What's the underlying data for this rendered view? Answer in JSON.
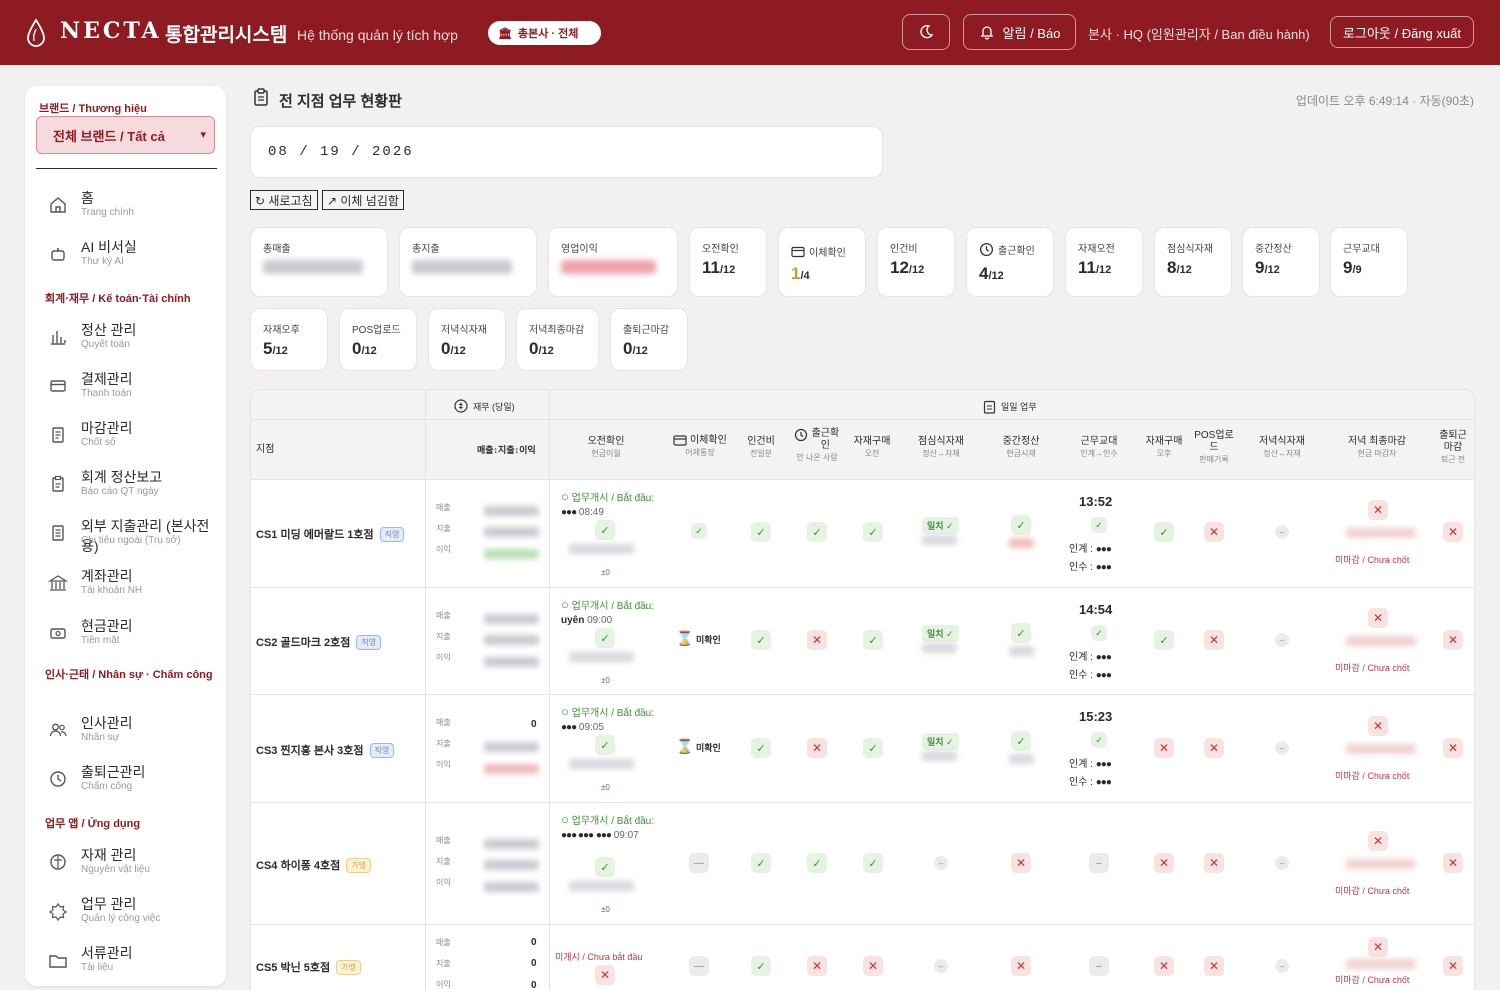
{
  "header": {
    "brand": "NECTA",
    "title_ko": "통합관리시스템",
    "title_vi": "Hệ thống quản lý tích hợp",
    "hq_badge": "총본사 · 전체",
    "alert_label": "알림 / Báo",
    "user_info": "본사 · HQ (임원관리자 / Ban điều hành)",
    "logout_label": "로그아웃 / Đăng xuất",
    "bg_color": "#8e1b22"
  },
  "sidebar": {
    "brand_label": "브랜드 / Thương hiệu",
    "brand_select": "전체 브랜드 / Tất cả",
    "sec_finance": "회계·재무 / Kế toán·Tài chính",
    "sec_hr": "인사·근태 / Nhân sự · Chấm công",
    "sec_app": "업무 앱 / Ứng dụng",
    "items": [
      {
        "ko": "홈",
        "vi": "Trang chính",
        "icon": "home-icon"
      },
      {
        "ko": "AI 비서실",
        "vi": "Thư ký AI",
        "icon": "robot-icon"
      },
      {
        "ko": "정산 관리",
        "vi": "Quyết toán",
        "icon": "bar-chart-icon"
      },
      {
        "ko": "결제관리",
        "vi": "Thanh toán",
        "icon": "card-icon"
      },
      {
        "ko": "마감관리",
        "vi": "Chốt số",
        "icon": "document-icon"
      },
      {
        "ko": "회계 정산보고",
        "vi": "Báo cáo QT ngày",
        "icon": "report-icon"
      },
      {
        "ko": "외부 지출관리 (본사전용)",
        "vi": "Chi tiêu ngoài (Trụ sở)",
        "icon": "expense-icon"
      },
      {
        "ko": "계좌관리",
        "vi": "Tài khoản NH",
        "icon": "bank-icon"
      },
      {
        "ko": "현금관리",
        "vi": "Tiền mặt",
        "icon": "cash-icon"
      },
      {
        "ko": "인사관리",
        "vi": "Nhân sự",
        "icon": "people-icon"
      },
      {
        "ko": "출퇴근관리",
        "vi": "Chấm công",
        "icon": "clock-icon"
      },
      {
        "ko": "자재 관리",
        "vi": "Nguyên vật liệu",
        "icon": "materials-icon"
      },
      {
        "ko": "업무 관리",
        "vi": "Quản lý công việc",
        "icon": "tasks-icon"
      },
      {
        "ko": "서류관리",
        "vi": "Tài liệu",
        "icon": "folder-icon"
      }
    ]
  },
  "main": {
    "title": "전 지점 업무 현황판",
    "updated": "업데이트 오후 6:49:14 · 자동(90초)",
    "date": "08 / 19 / 2026",
    "refresh_label": "↻ 새로고침",
    "transfer_label": "↗ 이체 넘김함"
  },
  "cards_row1": [
    {
      "label": "총매출",
      "blur": true,
      "color": "#c7c7d0"
    },
    {
      "label": "총지출",
      "blur": true,
      "color": "#c7c7d0"
    },
    {
      "label": "영업이익",
      "blur": true,
      "color": "#eea3ae"
    },
    {
      "label": "오전확인",
      "num": "11",
      "den": "/12"
    },
    {
      "label": "이체확인",
      "num": "1",
      "den": "/4",
      "icon": "card-icon",
      "num_color": "#d39a2c"
    },
    {
      "label": "인건비",
      "num": "12",
      "den": "/12"
    },
    {
      "label": "출근확인",
      "num": "4",
      "den": "/12",
      "icon": "clock-icon"
    },
    {
      "label": "자재오전",
      "num": "11",
      "den": "/12"
    },
    {
      "label": "점심식자재",
      "num": "8",
      "den": "/12"
    },
    {
      "label": "중간정산",
      "num": "9",
      "den": "/12"
    },
    {
      "label": "근무교대",
      "num": "9",
      "den": "/9"
    }
  ],
  "cards_row2": [
    {
      "label": "자재오후",
      "num": "5",
      "den": "/12"
    },
    {
      "label": "POS업로드",
      "num": "0",
      "den": "/12"
    },
    {
      "label": "저녁식자재",
      "num": "0",
      "den": "/12"
    },
    {
      "label": "저녁최종마감",
      "num": "0",
      "den": "/12"
    },
    {
      "label": "출퇴근마감",
      "num": "0",
      "den": "/12"
    }
  ],
  "table": {
    "group_finance": "재무 (당일)",
    "group_daily": "일일 업무",
    "col_branch": "지점",
    "col_fin": "매출↕지출↕이익",
    "columns": [
      {
        "t": "오전확인",
        "s": "현금이월"
      },
      {
        "t": "이체확인",
        "s": "어제통장"
      },
      {
        "t": "인건비",
        "s": "전일분"
      },
      {
        "t": "출근확인",
        "s": "안 나온 사람"
      },
      {
        "t": "자재구매",
        "s": "오전"
      },
      {
        "t": "점심식자재",
        "s": "정산↔자재"
      },
      {
        "t": "중간정산",
        "s": "현금시재"
      },
      {
        "t": "근무교대",
        "s": "인계→인수"
      },
      {
        "t": "자재구매",
        "s": "오후"
      },
      {
        "t": "POS업로드",
        "s": "판매기록"
      },
      {
        "t": "저녁식자재",
        "s": "정산↔자재"
      },
      {
        "t": "저녁 최종마감",
        "s": "현금 마감자"
      },
      {
        "t": "출퇴근 마감",
        "s": "퇴근 전"
      }
    ],
    "fin_labels": [
      "매출",
      "지출",
      "이익"
    ],
    "start_label": "업무개시 / Bắt đầu:",
    "not_started": "미개시 / Chưa bắt đầu",
    "unclosed": "미마감 / Chưa chốt",
    "unconfirmed": "미확인",
    "match": "일치 ✓",
    "handover": "인계 :",
    "takeover": "인수 :",
    "pm0": "±0",
    "zero": "0",
    "rows": [
      {
        "name": "CS1 미딩 에머랄드 1호점",
        "tag": "직영",
        "start_who": "●●●",
        "start_time": "08:49",
        "shift": "13:52"
      },
      {
        "name": "CS2 골드마크 2호점",
        "tag": "직영",
        "start_who": "uyên",
        "start_time": "09:00",
        "shift": "14:54"
      },
      {
        "name": "CS3 찐지홍 본사 3호점",
        "tag": "직영",
        "start_who": "●●●",
        "start_time": "09:05",
        "shift": "15:23"
      },
      {
        "name": "CS4 하이퐁 4호점",
        "tag": "가맹",
        "start_who": "●●● ●●●",
        "start_who2": "●●●",
        "start_time": "09:07"
      },
      {
        "name": "CS5 박닌 5호점",
        "tag": "가맹"
      }
    ]
  }
}
